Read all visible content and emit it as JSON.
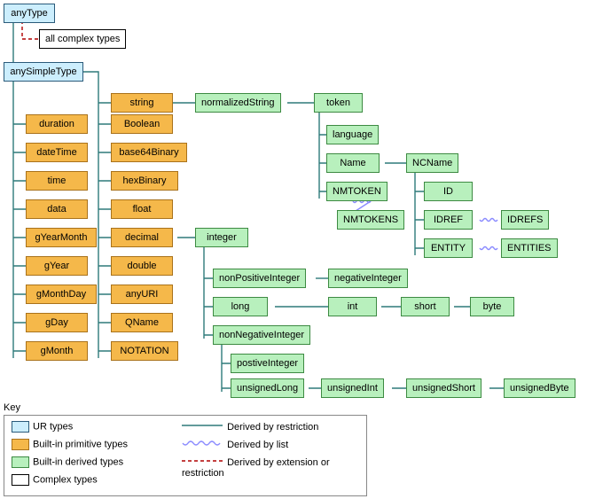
{
  "root": {
    "anyType": "anyType",
    "allComplex": "all complex types",
    "anySimpleType": "anySimpleType"
  },
  "col1": [
    "duration",
    "dateTime",
    "time",
    "data",
    "gYearMonth",
    "gYear",
    "gMonthDay",
    "gDay",
    "gMonth"
  ],
  "col2": [
    "string",
    "Boolean",
    "base64Binary",
    "hexBinary",
    "float",
    "decimal",
    "double",
    "anyURI",
    "QName",
    "NOTATION"
  ],
  "strTree": {
    "normalizedString": "normalizedString",
    "token": "token",
    "language": "language",
    "Name": "Name",
    "NMTOKEN": "NMTOKEN",
    "NMTOKENS": "NMTOKENS",
    "NCName": "NCName",
    "ID": "ID",
    "IDREF": "IDREF",
    "IDREFS": "IDREFS",
    "ENTITY": "ENTITY",
    "ENTITIES": "ENTITIES"
  },
  "intTree": {
    "integer": "integer",
    "nonPositiveInteger": "nonPositiveInteger",
    "negativeInteger": "negativeInteger",
    "long": "long",
    "int": "int",
    "short": "short",
    "byte": "byte",
    "nonNegativeInteger": "nonNegativeInteger",
    "postiveInteger": "postiveInteger",
    "unsignedLong": "unsignedLong",
    "unsignedInt": "unsignedInt",
    "unsignedShort": "unsignedShort",
    "unsignedByte": "unsignedByte"
  },
  "key": {
    "title": "Key",
    "ur": "UR types",
    "prim": "Built-in primitive types",
    "deriv": "Built-in derived types",
    "complex": "Complex types",
    "restrict": "Derived by restriction",
    "list": "Derived by list",
    "ext": "Derived by extension or restriction"
  }
}
